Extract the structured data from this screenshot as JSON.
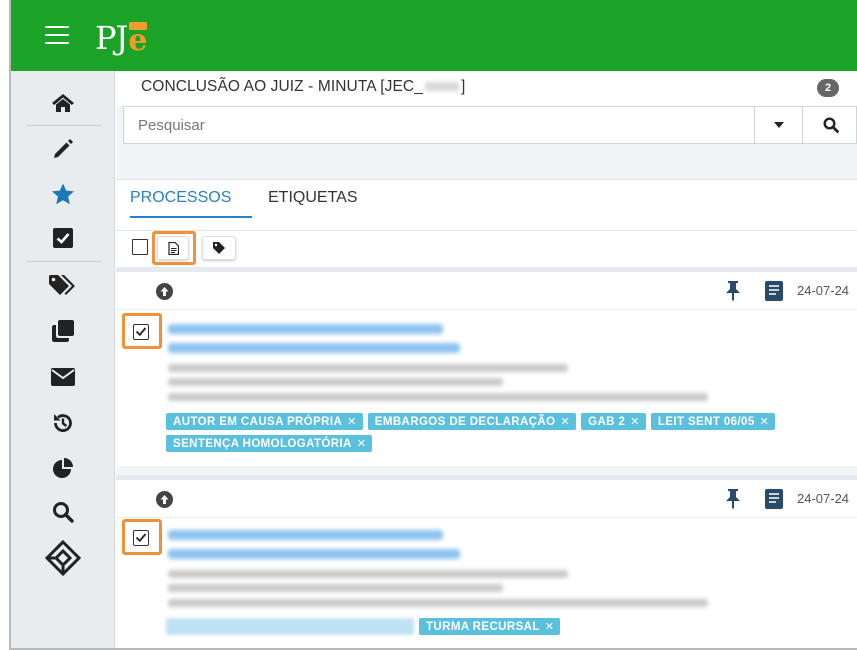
{
  "app": {
    "logo_text": "PJ",
    "logo_e": "e"
  },
  "header": {
    "title_prefix": "CONCLUSÃO AO JUIZ - MINUTA [JEC_",
    "title_suffix": "]",
    "count": "2"
  },
  "search": {
    "placeholder": "Pesquisar",
    "value": ""
  },
  "tabs": [
    {
      "label": "PROCESSOS",
      "active": true
    },
    {
      "label": "ETIQUETAS",
      "active": false
    }
  ],
  "colors": {
    "topbar": "#1aa326",
    "accent": "#2b80c4",
    "tag": "#5bc0de",
    "highlight": "#f0913a",
    "logo_e": "#f39c2b"
  },
  "sidebar": {
    "items": [
      {
        "icon": "home-icon"
      },
      {
        "icon": "pencil-icon"
      },
      {
        "icon": "star-icon"
      },
      {
        "icon": "check-square-icon"
      },
      {
        "icon": "tags-icon"
      },
      {
        "icon": "clone-icon"
      },
      {
        "icon": "envelope-icon"
      },
      {
        "icon": "history-icon"
      },
      {
        "icon": "pie-chart-icon"
      },
      {
        "icon": "search-icon"
      },
      {
        "icon": "pje-diamond-icon"
      }
    ]
  },
  "toolbar": {
    "icons": [
      "square-icon",
      "file-icon",
      "tag-icon"
    ]
  },
  "cards": [
    {
      "date": "24-07-24",
      "checked": true,
      "tags": [
        "AUTOR EM CAUSA PRÓPRIA",
        "EMBARGOS DE DECLARAÇÃO",
        "GAB 2",
        "LEIT SENT 06/05",
        "SENTENÇA HOMOLOGATÓRIA"
      ]
    },
    {
      "date": "24-07-24",
      "checked": true,
      "tags": [
        "TURMA RECURSAL"
      ]
    }
  ],
  "tag_remove_glyph": "✕"
}
